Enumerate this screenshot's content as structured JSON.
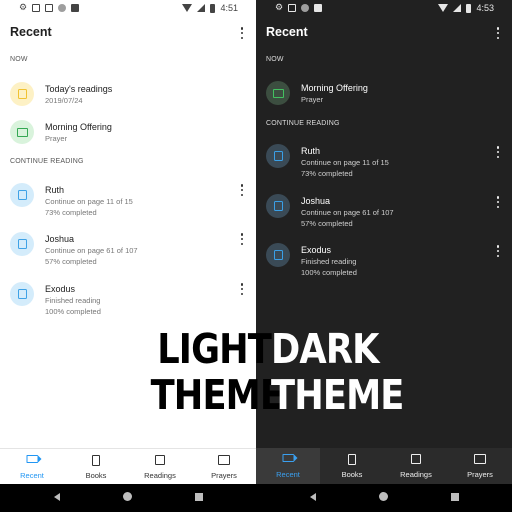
{
  "status": {
    "light_time": "4:51",
    "dark_time": "4:53"
  },
  "appbar": {
    "title": "Recent"
  },
  "sections": {
    "now": "NOW",
    "continue": "CONTINUE READING"
  },
  "light_now": [
    {
      "title": "Today's readings",
      "subtitle": "2019/07/24",
      "icon": "reading-icon"
    },
    {
      "title": "Morning Offering",
      "subtitle": "Prayer",
      "icon": "prayer-bubble-icon"
    }
  ],
  "dark_now": [
    {
      "title": "Morning Offering",
      "subtitle": "Prayer",
      "icon": "prayer-bubble-icon"
    }
  ],
  "continue": [
    {
      "title": "Ruth",
      "line1": "Continue on page 11 of 15",
      "line2": "73% completed"
    },
    {
      "title": "Joshua",
      "line1": "Continue on page 61 of 107",
      "line2": "57% completed"
    },
    {
      "title": "Exodus",
      "line1": "Finished reading",
      "line2": "100% completed"
    }
  ],
  "nav": {
    "recent": "Recent",
    "books": "Books",
    "readings": "Readings",
    "prayers": "Prayers"
  },
  "captions": {
    "light_1": "LIGHT",
    "light_2": "THEME",
    "dark_1": "DARK",
    "dark_2": "THEME"
  },
  "colors": {
    "accent": "#2196f3",
    "dark_bg": "#212121",
    "light_bg": "#ffffff"
  }
}
